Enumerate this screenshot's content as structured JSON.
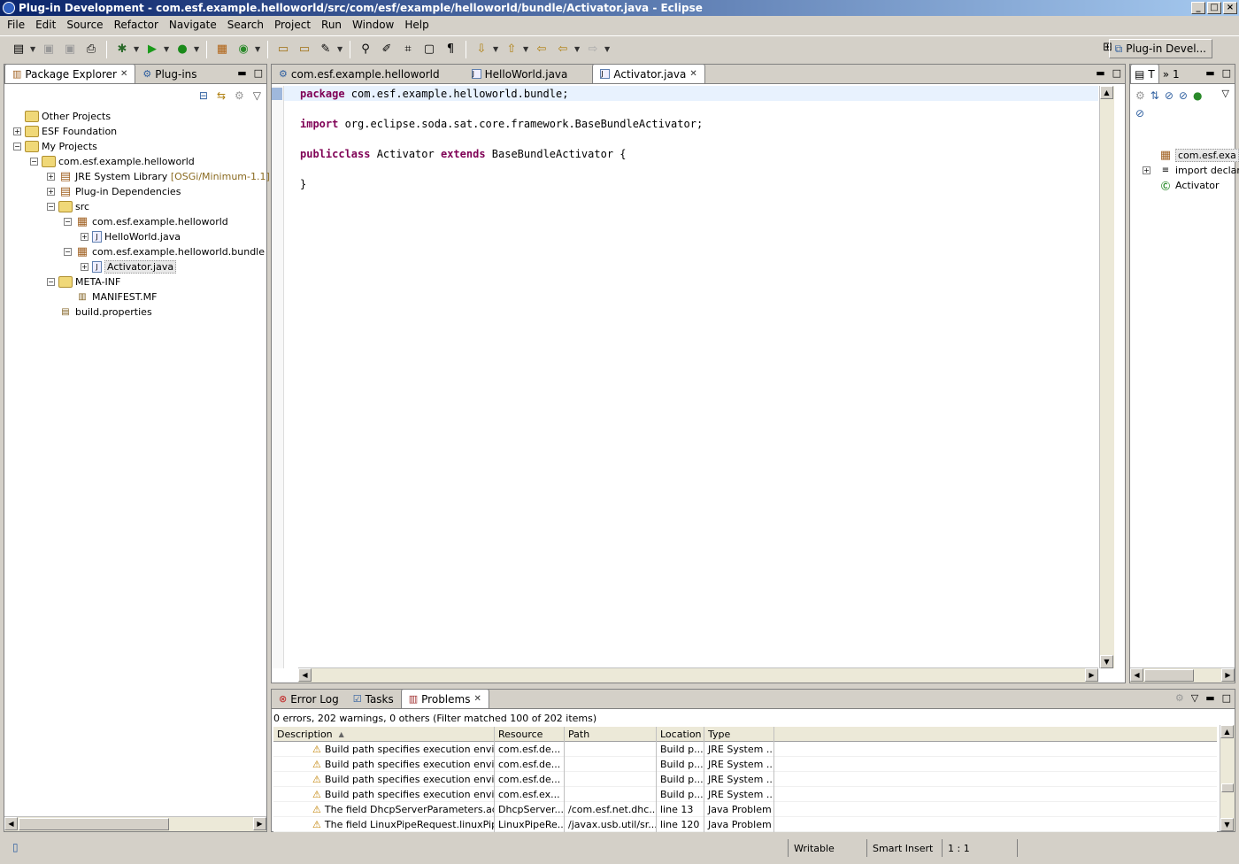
{
  "window": {
    "title": "Plug-in Development - com.esf.example.helloworld/src/com/esf/example/helloworld/bundle/Activator.java - Eclipse",
    "controls": [
      "_",
      "□",
      "×"
    ]
  },
  "menu": [
    "File",
    "Edit",
    "Source",
    "Refactor",
    "Navigate",
    "Search",
    "Project",
    "Run",
    "Window",
    "Help"
  ],
  "perspective": {
    "label": "Plug-in Devel..."
  },
  "explorer": {
    "tabs": [
      {
        "label": "Package Explorer",
        "active": true
      },
      {
        "label": "Plug-ins",
        "active": false
      }
    ],
    "tree": [
      {
        "label": "Other Projects",
        "decor": ""
      },
      {
        "label": "ESF Foundation",
        "decor": ""
      },
      {
        "label": "My Projects",
        "decor": ""
      },
      {
        "label": "com.esf.example.helloworld",
        "decor": ""
      },
      {
        "label": "JRE System Library",
        "decor": "[OSGi/Minimum-1.1]"
      },
      {
        "label": "Plug-in Dependencies",
        "decor": ""
      },
      {
        "label": "src",
        "decor": ""
      },
      {
        "label": "com.esf.example.helloworld",
        "decor": ""
      },
      {
        "label": "HelloWorld.java",
        "decor": ""
      },
      {
        "label": "com.esf.example.helloworld.bundle",
        "decor": ""
      },
      {
        "label": "Activator.java",
        "decor": ""
      },
      {
        "label": "META-INF",
        "decor": ""
      },
      {
        "label": "MANIFEST.MF",
        "decor": ""
      },
      {
        "label": "build.properties",
        "decor": ""
      }
    ]
  },
  "editor": {
    "tabs": [
      {
        "label": "com.esf.example.helloworld",
        "active": false
      },
      {
        "label": "HelloWorld.java",
        "active": false
      },
      {
        "label": "Activator.java",
        "active": true
      }
    ],
    "code": {
      "l1_kw": "package",
      "l1_rest": " com.esf.example.helloworld.bundle;",
      "l3_kw": "import",
      "l3_rest": " org.eclipse.soda.sat.core.framework.BaseBundleActivator;",
      "l5_kw1": "public",
      "l5_kw2": "class",
      "l5_mid": " Activator ",
      "l5_kw3": "extends",
      "l5_rest": " BaseBundleActivator {",
      "l7": "}"
    }
  },
  "outline": {
    "tabs": [
      {
        "label": "T"
      },
      {
        "label": "1"
      }
    ],
    "items": [
      {
        "label": "com.esf.exa"
      },
      {
        "label": "import declar"
      },
      {
        "label": "Activator"
      }
    ]
  },
  "bottom": {
    "tabs": [
      {
        "label": "Error Log",
        "active": false
      },
      {
        "label": "Tasks",
        "active": false
      },
      {
        "label": "Problems",
        "active": true
      }
    ],
    "summary": "0 errors, 202 warnings, 0 others (Filter matched 100 of 202 items)",
    "columns": [
      "Description",
      "Resource",
      "Path",
      "Location",
      "Type"
    ],
    "rows": [
      [
        "Build path specifies execution environm",
        "com.esf.de...",
        "",
        "Build p...",
        "JRE System ..."
      ],
      [
        "Build path specifies execution environm",
        "com.esf.de...",
        "",
        "Build p...",
        "JRE System ..."
      ],
      [
        "Build path specifies execution environm",
        "com.esf.de...",
        "",
        "Build p...",
        "JRE System ..."
      ],
      [
        "Build path specifies execution environm",
        "com.esf.ex...",
        "",
        "Build p...",
        "JRE System ..."
      ],
      [
        "The field DhcpServerParameters.adapt",
        "DhcpServer...",
        "/com.esf.net.dhc...",
        "line 13",
        "Java Problem"
      ],
      [
        "The field LinuxPipeRequest.linuxPipeIm",
        "LinuxPipeRe...",
        "/javax.usb.util/sr...",
        "line 120",
        "Java Problem"
      ]
    ]
  },
  "status": {
    "writable": "Writable",
    "insert": "Smart Insert",
    "position": "1 : 1"
  }
}
